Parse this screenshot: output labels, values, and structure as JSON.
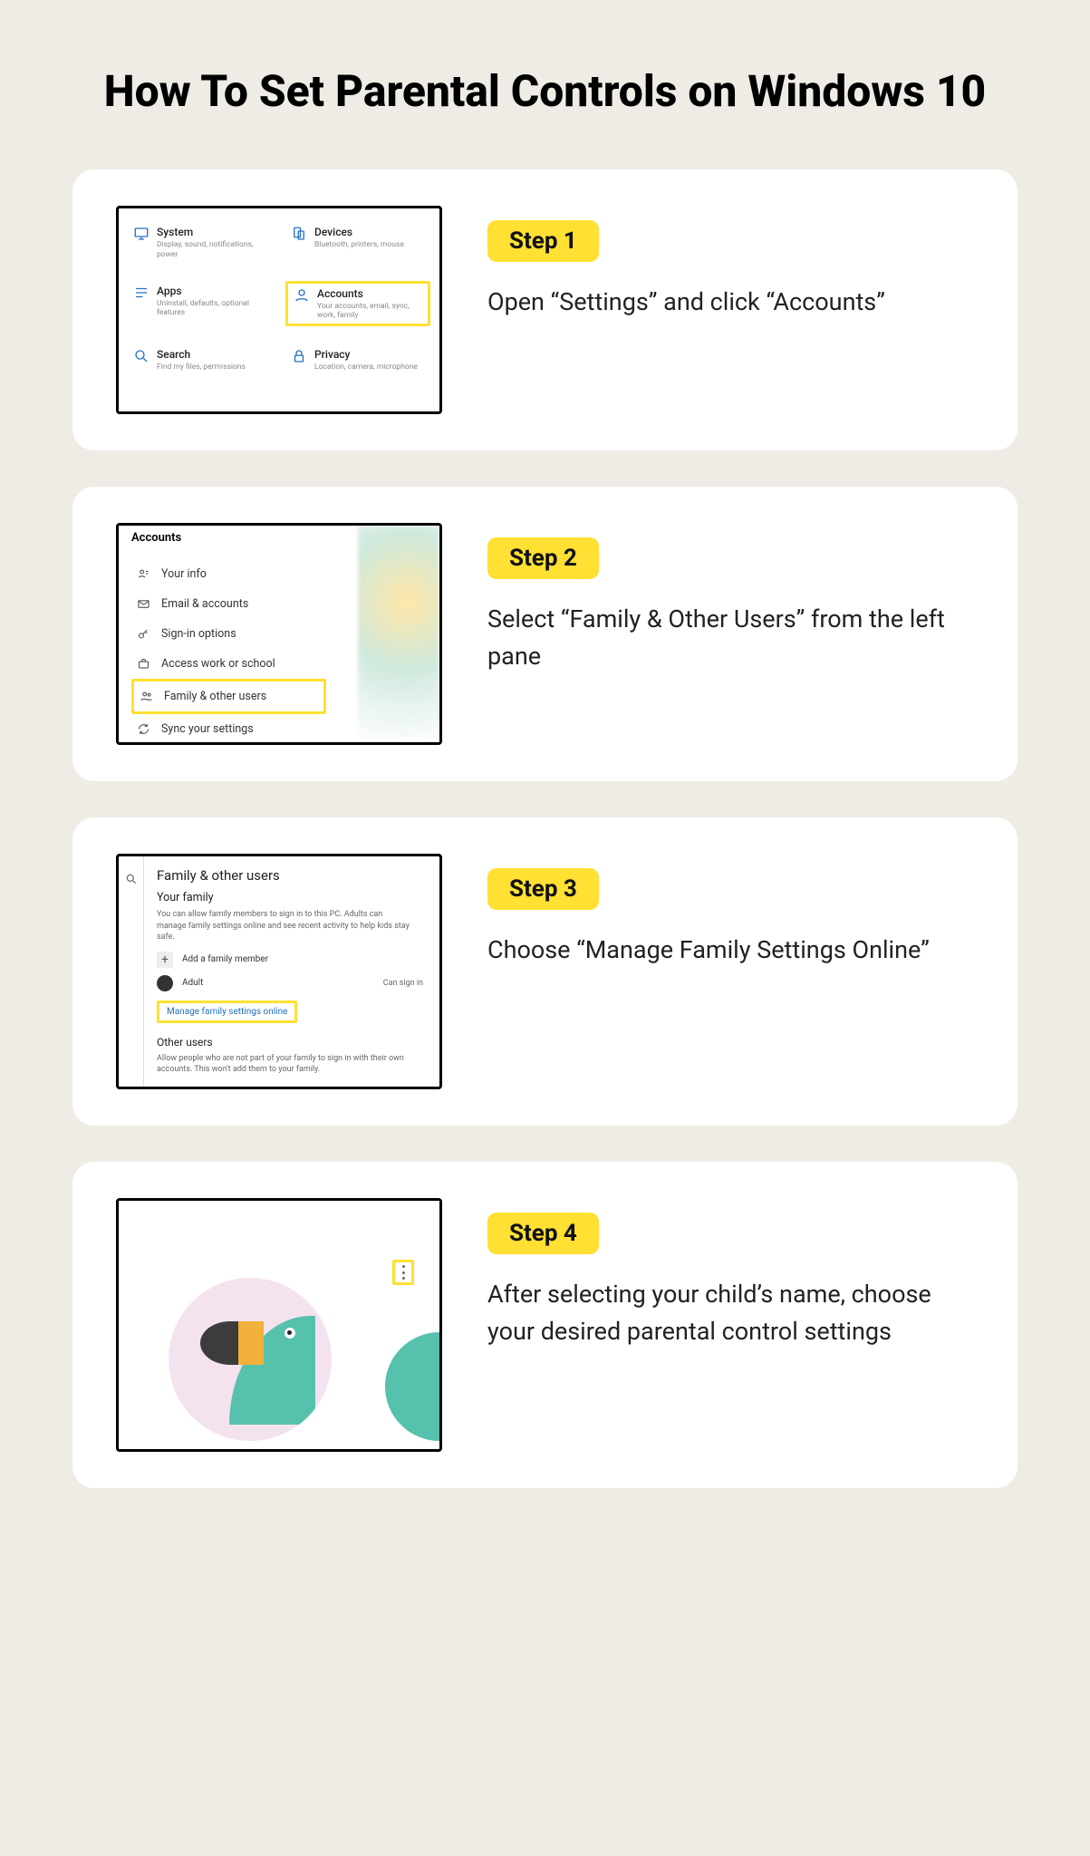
{
  "title": "How To Set Parental Controls on Windows 10",
  "steps": [
    {
      "badge": "Step 1",
      "text": "Open “Settings” and click “Accounts”"
    },
    {
      "badge": "Step 2",
      "text": "Select “Family & Other Users” from the left pane"
    },
    {
      "badge": "Step 3",
      "text": "Choose “Manage Family Settings Online”"
    },
    {
      "badge": "Step 4",
      "text": "After selecting your child’s name, choose your desired parental control settings"
    }
  ],
  "settings_tiles": [
    {
      "label": "System",
      "sub": "Display, sound, notifications, power"
    },
    {
      "label": "Devices",
      "sub": "Bluetooth, printers, mouse"
    },
    {
      "label": "Apps",
      "sub": "Uninstall, defaults, optional features"
    },
    {
      "label": "Accounts",
      "sub": "Your accounts, email, sync, work, family",
      "highlighted": true
    },
    {
      "label": "Search",
      "sub": "Find my files, permissions"
    },
    {
      "label": "Privacy",
      "sub": "Location, camera, microphone"
    }
  ],
  "accounts_nav": {
    "header": "Accounts",
    "items": [
      {
        "label": "Your info"
      },
      {
        "label": "Email & accounts"
      },
      {
        "label": "Sign-in options"
      },
      {
        "label": "Access work or school"
      },
      {
        "label": "Family & other users",
        "highlighted": true
      },
      {
        "label": "Sync your settings"
      }
    ]
  },
  "family": {
    "title": "Family & other users",
    "subtitle": "Your family",
    "desc": "You can allow family members to sign in to this PC. Adults can manage family settings online and see recent activity to help kids stay safe.",
    "add_label": "Add a family member",
    "adult_label": "Adult",
    "can_signin": "Can sign in",
    "manage_link": "Manage family settings online",
    "other_title": "Other users",
    "other_desc": "Allow people who are not part of your family to sign in with their own accounts. This won't add them to your family."
  }
}
